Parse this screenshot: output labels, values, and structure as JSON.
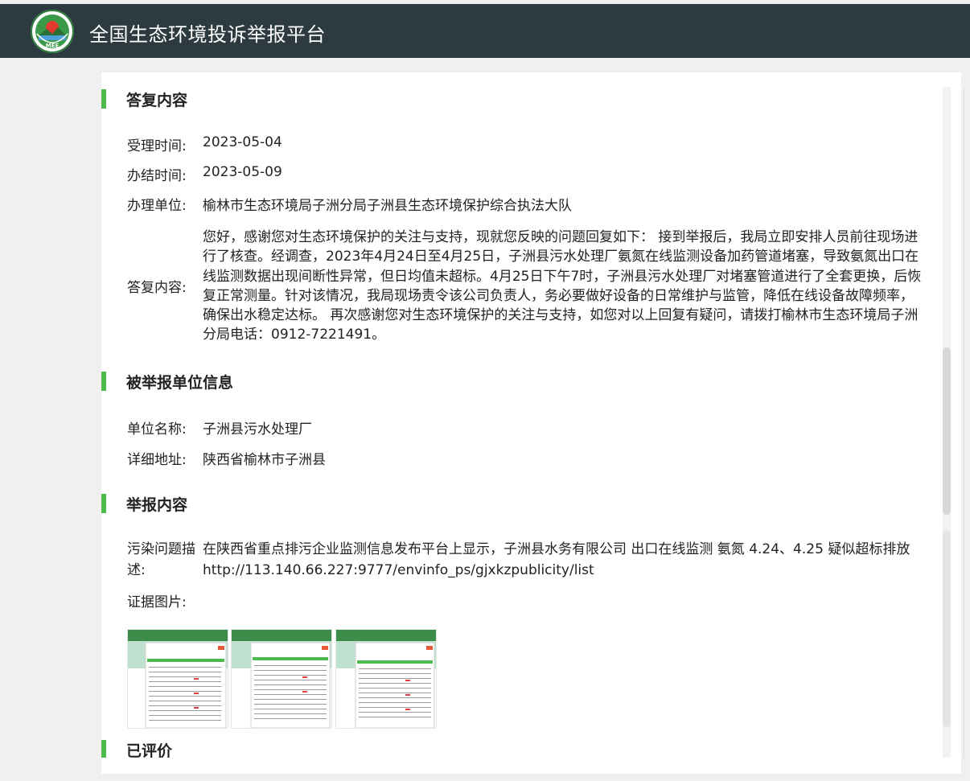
{
  "header": {
    "logo_text": "MEE",
    "title": "全国生态环境投诉举报平台"
  },
  "reply": {
    "section_title": "答复内容",
    "accept_time_label": "受理时间:",
    "accept_time": "2023-05-04",
    "finish_time_label": "办结时间:",
    "finish_time": "2023-05-09",
    "unit_label": "办理单位:",
    "unit": "榆林市生态环境局子洲分局子洲县生态环境保护综合执法大队",
    "content_label": "答复内容:",
    "content": "您好，感谢您对生态环境保护的关注与支持，现就您反映的问题回复如下： 接到举报后，我局立即安排人员前往现场进行了核查。经调查，2023年4月24日至4月25日，子洲县污水处理厂氨氮在线监测设备加药管道堵塞，导致氨氮出口在线监测数据出现间断性异常，但日均值未超标。4月25日下午7时，子洲县污水处理厂对堵塞管道进行了全套更换，后恢复正常测量。针对该情况，我局现场责令该公司负责人，务必要做好设备的日常维护与监管，降低在线设备故障频率，确保出水稳定达标。 再次感谢您对生态环境保护的关注与支持，如您对以上回复有疑问，请拨打榆林市生态环境局子洲分局电话：0912-7221491。"
  },
  "reported_unit": {
    "section_title": "被举报单位信息",
    "name_label": "单位名称:",
    "name": "子洲县污水处理厂",
    "address_label": "详细地址:",
    "address": "陕西省榆林市子洲县"
  },
  "report": {
    "section_title": "举报内容",
    "desc_label": "污染问题描述:",
    "desc": "在陕西省重点排污企业监测信息发布平台上显示，子洲县水务有限公司 出口在线监测 氨氮 4.24、4.25 疑似超标排放 http://113.140.66.227:9777/envinfo_ps/gjxkzpublicity/list",
    "evidence_label": "证据图片:"
  },
  "evaluation": {
    "section_title": "已评价"
  },
  "colors": {
    "topbar": "#2d3a3f",
    "accent_green": "#4cbb4c",
    "panel_bg": "#ffffff",
    "page_bg": "#f0f0f0"
  }
}
